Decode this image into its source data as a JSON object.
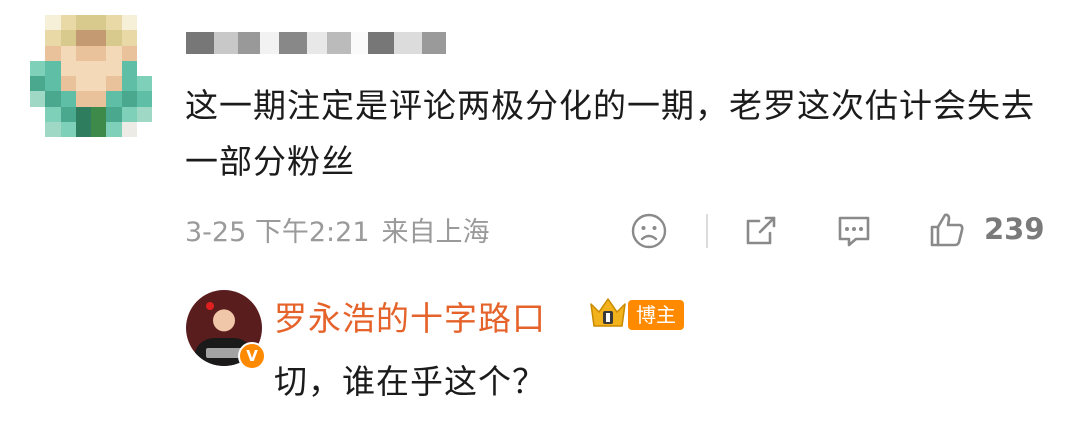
{
  "comment": {
    "text": "这一期注定是评论两极分化的一期，老罗这次估计会失去一部分粉丝",
    "time": "3-25 下午2:21",
    "location": "来自上海",
    "like_count": "239"
  },
  "reply": {
    "author": "罗永浩的十字路口",
    "badge": "博主",
    "verified_mark": "V",
    "text": "切，谁在乎这个？"
  },
  "icons": {
    "dislike": "sad-face-icon",
    "share": "share-icon",
    "comment": "comment-icon",
    "like": "thumbs-up-icon"
  },
  "colors": {
    "author_name": "#e5632a",
    "badge": "#ff8a00",
    "meta_text": "#9a9a9a"
  }
}
